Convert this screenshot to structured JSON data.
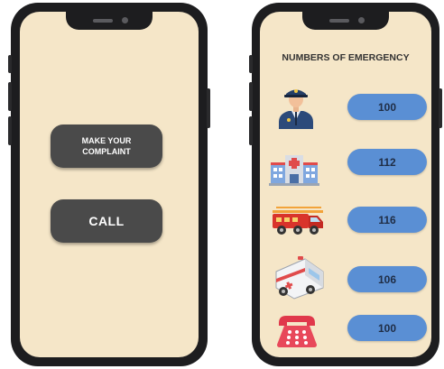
{
  "left_screen": {
    "complaint_label": "MAKE YOUR COMPLAINT",
    "call_label": "CALL"
  },
  "right_screen": {
    "title": "NUMBERS OF EMERGENCY",
    "items": [
      {
        "icon": "police-officer-icon",
        "number": "100"
      },
      {
        "icon": "hospital-icon",
        "number": "112"
      },
      {
        "icon": "fire-truck-icon",
        "number": "116"
      },
      {
        "icon": "ambulance-icon",
        "number": "106"
      },
      {
        "icon": "telephone-icon",
        "number": "100"
      }
    ]
  },
  "colors": {
    "screen_background": "#f5e6c8",
    "dark_button": "#4a4a4a",
    "number_button": "#5a8fd4",
    "phone_frame": "#1d1d1f"
  }
}
